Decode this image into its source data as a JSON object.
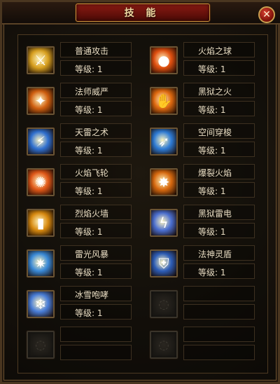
{
  "window": {
    "title": "技 能",
    "close_label": "✕"
  },
  "level_label": "等级:",
  "skills": [
    {
      "name": "普通攻击",
      "level": "1",
      "icon": "sword-strike-icon",
      "color": "#d8a020"
    },
    {
      "name": "火焰之球",
      "level": "1",
      "icon": "fireball-icon",
      "color": "#e05010"
    },
    {
      "name": "法师威严",
      "level": "1",
      "icon": "mage-majesty-icon",
      "color": "#d06010"
    },
    {
      "name": "黑狱之火",
      "level": "1",
      "icon": "hellfire-hand-icon",
      "color": "#e06a10"
    },
    {
      "name": "天雷之术",
      "level": "1",
      "icon": "thunder-spell-icon",
      "color": "#3070d0"
    },
    {
      "name": "空间穿梭",
      "level": "1",
      "icon": "space-shuttle-icon",
      "color": "#2f7cd6"
    },
    {
      "name": "火焰飞轮",
      "level": "1",
      "icon": "fire-wheel-icon",
      "color": "#e05818"
    },
    {
      "name": "爆裂火焰",
      "level": "1",
      "icon": "burst-flame-icon",
      "color": "#d86a10"
    },
    {
      "name": "烈焰火墙",
      "level": "1",
      "icon": "fire-wall-icon",
      "color": "#d88a10"
    },
    {
      "name": "黑狱雷电",
      "level": "1",
      "icon": "hell-lightning-icon",
      "color": "#4b6fd0"
    },
    {
      "name": "雷光风暴",
      "level": "1",
      "icon": "lightning-storm-icon",
      "color": "#3a8ad8"
    },
    {
      "name": "法神灵盾",
      "level": "1",
      "icon": "spirit-shield-icon",
      "color": "#2e5eb8"
    },
    {
      "name": "冰雪咆哮",
      "level": "1",
      "icon": "ice-roar-icon",
      "color": "#4a7ed8"
    },
    {
      "name": "",
      "level": "",
      "icon": "empty-slot-icon",
      "color": ""
    },
    {
      "name": "",
      "level": "",
      "icon": "empty-slot-icon",
      "color": ""
    },
    {
      "name": "",
      "level": "",
      "icon": "empty-slot-icon",
      "color": ""
    }
  ]
}
